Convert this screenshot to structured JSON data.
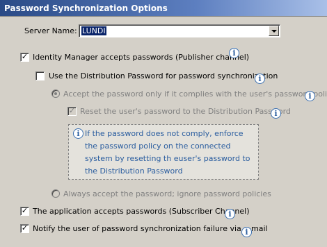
{
  "title": "Password Synchronization Options",
  "server": {
    "label": "Server Name:",
    "value": "LUNDI"
  },
  "options": {
    "idm_accepts": {
      "label": "Identity Manager accepts passwords (Publisher channel)",
      "checked": true
    },
    "use_distribution": {
      "label": "Use the Distribution Password for password synchronization",
      "checked": false
    },
    "accept_only_complies": {
      "label": "Accept the password only if it complies with the user's password policy",
      "selected": true,
      "enabled": false
    },
    "reset_password": {
      "label": "Reset the user's password to the Distribution Password",
      "checked": true,
      "enabled": false
    },
    "note": "If the password does not comply, enforce the password policy on the connected system by resetting th euser's password to the Distribution Password",
    "always_accept": {
      "label": "Always accept the password; ignore password policies",
      "selected": false,
      "enabled": false
    },
    "app_accepts": {
      "label": "The application accepts passwords (Subscriber Channel)",
      "checked": true
    },
    "notify_user": {
      "label": "Notify the user of password synchronization failure via e-mail",
      "checked": true
    }
  },
  "icons": {
    "info": "info-icon",
    "dropdown": "chevron-down-icon"
  },
  "colors": {
    "title_bar": "#2a4a86",
    "note_text": "#2a5d9f",
    "selection": "#0a246a"
  }
}
